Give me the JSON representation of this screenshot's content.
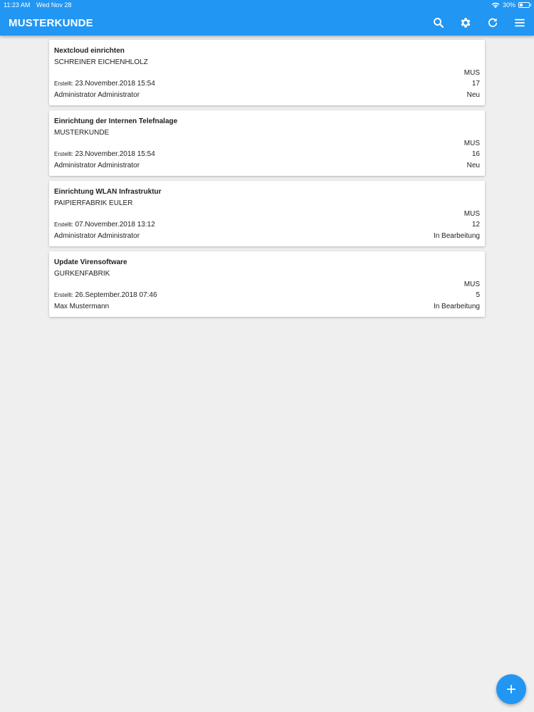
{
  "status_bar": {
    "time": "11:23 AM",
    "date": "Wed Nov 28",
    "battery": "30%",
    "battery_level": 0.3,
    "wifi_icon": "wifi-icon"
  },
  "header": {
    "title": "MUSTERKUNDE",
    "icons": [
      "search-icon",
      "gear-icon",
      "refresh-icon",
      "menu-icon"
    ]
  },
  "colors": {
    "primary": "#2196f3",
    "background": "#efeff0",
    "card": "#ffffff"
  },
  "tickets": [
    {
      "title": "Nextcloud einrichten",
      "customer": "SCHREINER EICHENHLOLZ",
      "code": "MUS",
      "created_label": "Erstellt:",
      "created": "23.November.2018 15:54",
      "number": "17",
      "user": "Administrator Administrator",
      "status": "Neu"
    },
    {
      "title": "Einrichtung der Internen Telefnalage",
      "customer": "MUSTERKUNDE",
      "code": "MUS",
      "created_label": "Erstellt:",
      "created": "23.November.2018 15:54",
      "number": "16",
      "user": "Administrator Administrator",
      "status": "Neu"
    },
    {
      "title": "Einrichtung WLAN Infrastruktur",
      "customer": "PAIPIERFABRIK EULER",
      "code": "MUS",
      "created_label": "Erstellt:",
      "created": "07.November.2018 13:12",
      "number": "12",
      "user": "Administrator Administrator",
      "status": "In Bearbeitung"
    },
    {
      "title": "Update Virensoftware",
      "customer": "GURKENFABRIK",
      "code": "MUS",
      "created_label": "Erstellt:",
      "created": "26.September.2018 07:46",
      "number": "5",
      "user": "Max Mustermann",
      "status": "In Bearbeitung"
    }
  ],
  "fab": {
    "icon": "plus-icon"
  }
}
